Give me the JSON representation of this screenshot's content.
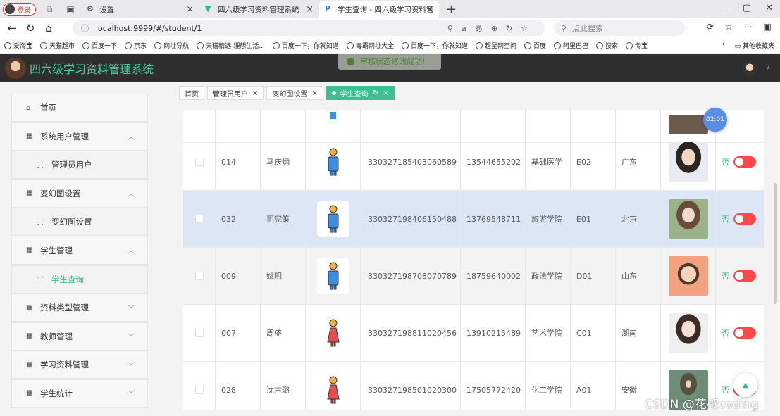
{
  "browser": {
    "login_label": "登录",
    "tabs": [
      {
        "label": "设置"
      },
      {
        "label": "四六级学习资料管理系统"
      },
      {
        "label": "学生查询 - 四六级学习资料管理系"
      }
    ],
    "url": "localhost:9999/#/student/1",
    "search_placeholder": "点此搜索",
    "bookmarks": [
      "爱淘宝",
      "天猫超市",
      "百度一下",
      "京东",
      "网址导航",
      "天猫精选-理想生活...",
      "百度一下，你就知道",
      "毒霸网址大全",
      "百度一下，你就知道",
      "超星网空间",
      "百度",
      "阿里巴巴",
      "搜索",
      "淘宝"
    ],
    "other_bookmarks": "其他收藏夹"
  },
  "app": {
    "title": "四六级学习资料管理系统",
    "toast": "审核状态修改成功!"
  },
  "sidebar": {
    "items": [
      {
        "label": "首页",
        "icon": "home-icon",
        "type": "item"
      },
      {
        "label": "系统用户管理",
        "icon": "grid-icon",
        "type": "group",
        "arrow": "up"
      },
      {
        "label": "管理员用户",
        "icon": "sub-grid-icon",
        "type": "sub"
      },
      {
        "label": "变幻图设置",
        "icon": "grid-icon",
        "type": "group",
        "arrow": "up"
      },
      {
        "label": "变幻图设置",
        "icon": "sub-grid-icon",
        "type": "sub"
      },
      {
        "label": "学生管理",
        "icon": "grid-icon",
        "type": "group",
        "arrow": "up"
      },
      {
        "label": "学生查询",
        "icon": "sub-grid-icon",
        "type": "sub",
        "active": true
      },
      {
        "label": "资料类型管理",
        "icon": "grid-icon",
        "type": "group",
        "arrow": "down"
      },
      {
        "label": "教师管理",
        "icon": "grid-icon",
        "type": "group",
        "arrow": "down"
      },
      {
        "label": "学习资料管理",
        "icon": "grid-icon",
        "type": "group",
        "arrow": "down"
      },
      {
        "label": "学生统计",
        "icon": "grid-icon",
        "type": "group",
        "arrow": "down"
      }
    ]
  },
  "breadcrumb_tabs": [
    {
      "label": "首页"
    },
    {
      "label": "管理员用户"
    },
    {
      "label": "变幻图设置"
    },
    {
      "label": "学生查询",
      "active": true
    }
  ],
  "table": {
    "rows": [
      {
        "no": "014",
        "name": "马庆炳",
        "gender": "male",
        "id": "330327185403060589",
        "phone": "13544655202",
        "college": "基础医学",
        "class": "E02",
        "province": "广东",
        "audit": "否"
      },
      {
        "no": "032",
        "name": "司宪策",
        "gender": "male",
        "id": "330327198406150488",
        "phone": "13769548711",
        "college": "旅游学院",
        "class": "E01",
        "province": "北京",
        "audit": "否"
      },
      {
        "no": "009",
        "name": "姚明",
        "gender": "male",
        "id": "330327198708070789",
        "phone": "18759640002",
        "college": "政法学院",
        "class": "D01",
        "province": "山东",
        "audit": "否"
      },
      {
        "no": "007",
        "name": "周盛",
        "gender": "female",
        "id": "330327198811020456",
        "phone": "13910215489",
        "college": "艺术学院",
        "class": "C01",
        "province": "湖南",
        "audit": "否"
      },
      {
        "no": "028",
        "name": "沈古璐",
        "gender": "female",
        "id": "330327198501020300",
        "phone": "17505772420",
        "college": "化工学院",
        "class": "A01",
        "province": "安徽",
        "audit": "否"
      }
    ]
  },
  "timer_badge": "02:01",
  "watermark": "CSDN @花椒coding",
  "colors": {
    "accent": "#3dbf8f",
    "switch_off": "#ff4949",
    "header_bg": "#2e2e2e",
    "title": "#4ad2a4"
  }
}
